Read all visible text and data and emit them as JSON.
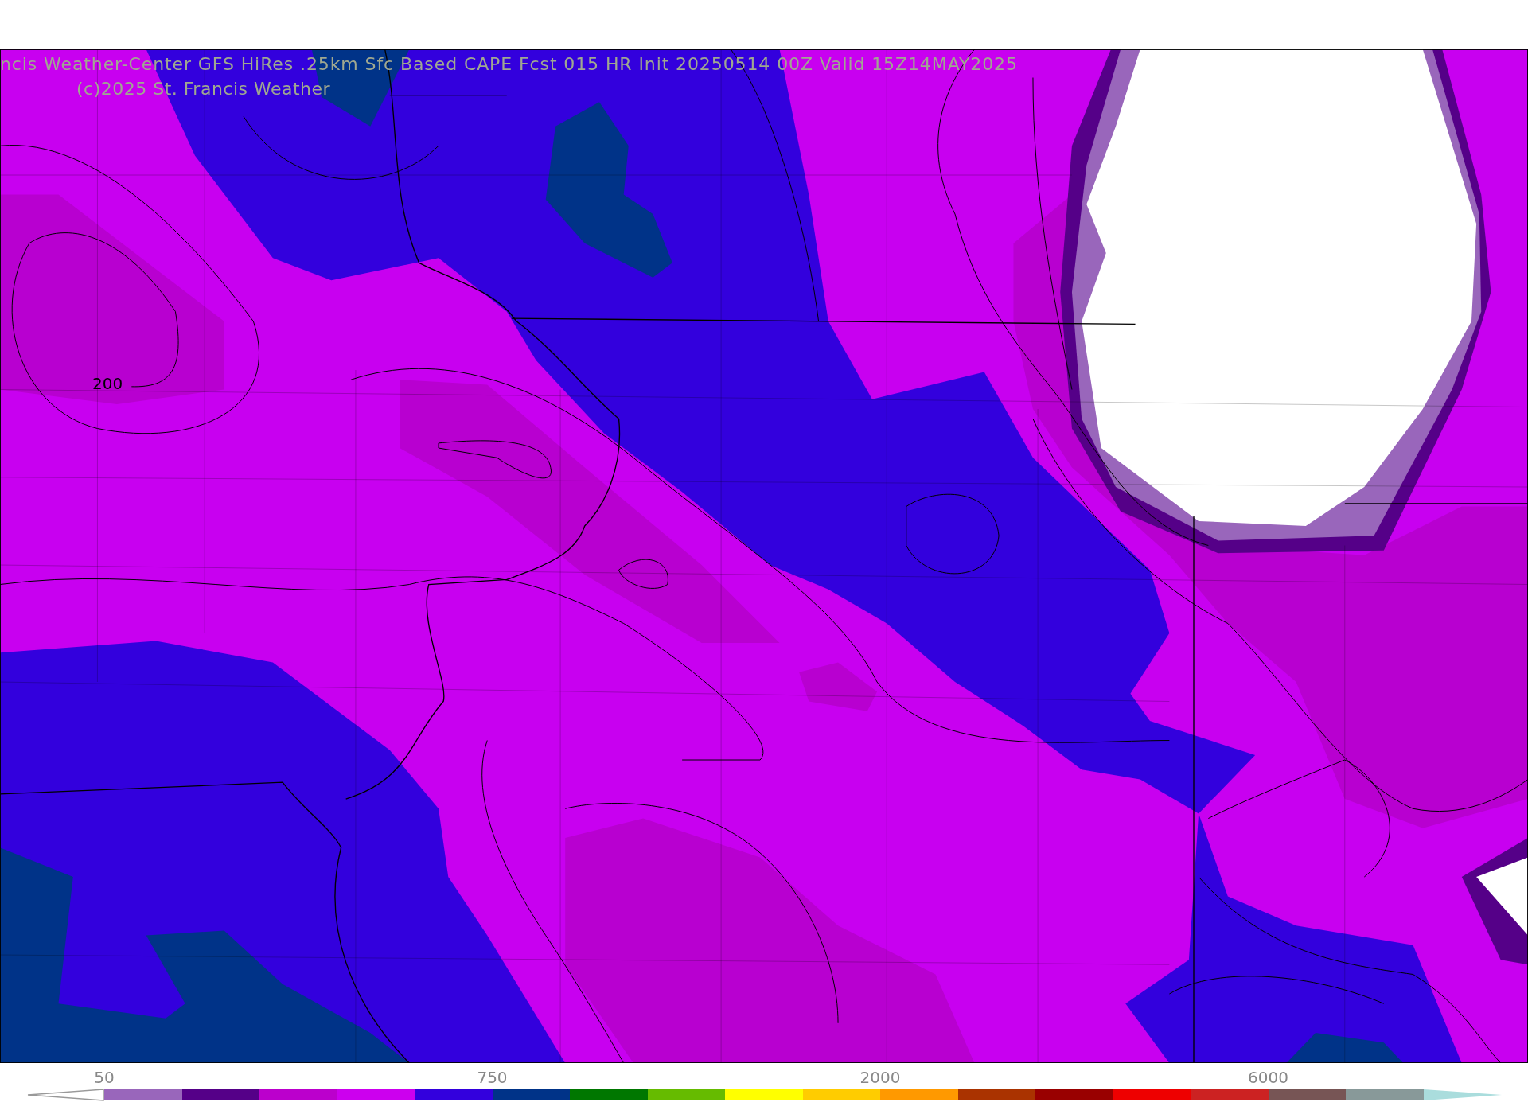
{
  "map": {
    "title": "ncis Weather-Center GFS HiRes .25km Sfc Based CAPE  Fcst 015 HR Init 20250514 00Z  Valid 15Z14MAY2025",
    "credit": "(c)2025 St. Francis Weather",
    "contour_label": "200"
  },
  "colorbar": {
    "segments": [
      {
        "kind": "under"
      },
      {
        "kind": "segment",
        "color": "#9966bb",
        "label": "50"
      },
      {
        "kind": "segment",
        "color": "#550088"
      },
      {
        "kind": "segment",
        "color": "#bb00cc"
      },
      {
        "kind": "segment",
        "color": "#cc00ee"
      },
      {
        "kind": "segment",
        "color": "#3300dd"
      },
      {
        "kind": "segment",
        "color": "#003388",
        "label": "750"
      },
      {
        "kind": "segment",
        "color": "#007700"
      },
      {
        "kind": "segment",
        "color": "#66bb00"
      },
      {
        "kind": "segment",
        "color": "#ffff00"
      },
      {
        "kind": "segment",
        "color": "#ffcc00"
      },
      {
        "kind": "segment",
        "color": "#ff9900",
        "label": "2000"
      },
      {
        "kind": "segment",
        "color": "#aa3300"
      },
      {
        "kind": "segment",
        "color": "#990000"
      },
      {
        "kind": "segment",
        "color": "#ee0000"
      },
      {
        "kind": "segment",
        "color": "#cc2222"
      },
      {
        "kind": "segment",
        "color": "#775555",
        "label": "6000"
      },
      {
        "kind": "segment",
        "color": "#889999"
      },
      {
        "kind": "over",
        "color": "#aadddd"
      }
    ]
  }
}
